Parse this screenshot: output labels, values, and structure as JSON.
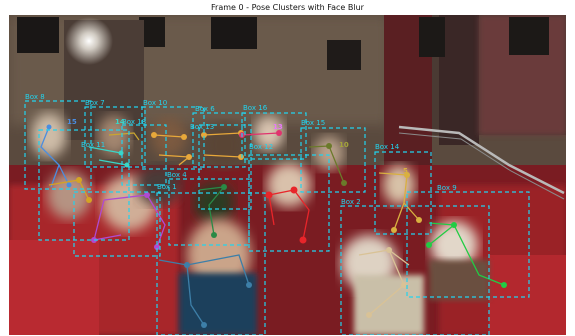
{
  "figure": {
    "title": "Frame 0 - Pose Clusters with Face Blur"
  },
  "colors": {
    "box_outline": "#22d3ee",
    "box_label": "#22d3ee",
    "id_label": "#e879f9"
  },
  "boxes": [
    {
      "label": "Box 8"
    },
    {
      "label": "Box 7"
    },
    {
      "label": "Box 10"
    },
    {
      "label": "Box 6"
    },
    {
      "label": "Box 16"
    },
    {
      "label": "Box 15"
    },
    {
      "label": "Box 18"
    },
    {
      "label": "Box 11"
    },
    {
      "label": "Box 12"
    },
    {
      "label": "Box 13"
    },
    {
      "label": "Box 14"
    },
    {
      "label": "Box 1"
    },
    {
      "label": "Box 2"
    },
    {
      "label": "Box 9"
    },
    {
      "label": "Box 4"
    }
  ],
  "id_labels": [
    {
      "text": "15"
    },
    {
      "text": "14"
    },
    {
      "text": "13"
    },
    {
      "text": "10"
    },
    {
      "text": "5"
    }
  ]
}
